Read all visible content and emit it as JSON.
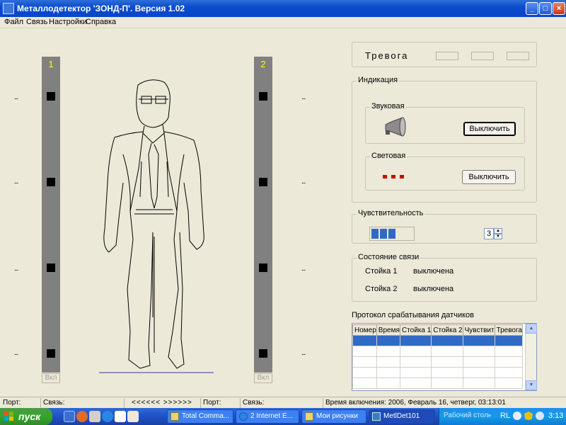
{
  "window": {
    "title": "Металлодетектор 'ЗОНД-П'. Версия 1.02",
    "min": "_",
    "max": "□",
    "close": "×"
  },
  "menu": [
    "Файл",
    "Связь",
    "Настройки",
    "Справка"
  ],
  "columns": [
    {
      "number": "1",
      "button": "Вкл"
    },
    {
      "number": "2",
      "button": "Вкл"
    }
  ],
  "dots": "...",
  "alarm": {
    "label": "Тревога"
  },
  "indication": {
    "title": "Индикация",
    "sound": {
      "title": "Звуковая",
      "button": "Выключить"
    },
    "light": {
      "title": "Световая",
      "button": "Выключить",
      "led_color": "#d40000"
    }
  },
  "sensitivity": {
    "title": "Чувствительность",
    "level": 3,
    "max_level": 5,
    "value": "3"
  },
  "connection": {
    "title": "Состояние связи",
    "rows": [
      {
        "name": "Стойка 1",
        "state": "выключена"
      },
      {
        "name": "Стойка 2",
        "state": "выключена"
      }
    ]
  },
  "log": {
    "title": "Протокол срабатывания датчиков",
    "columns": [
      "Номер",
      "Время",
      "Стойка 1",
      "Стойка 2",
      "Чувствит",
      "Тревога"
    ],
    "rows": 5
  },
  "statusbar": {
    "port_label": "Порт:",
    "link_label": "Связь:",
    "arrows": "<<<<<<  >>>>>>",
    "port_label2": "Порт:",
    "link_label2": "Связь:",
    "start_time": "Время включения: 2006, Февраль 16, четверг,  03:13:01"
  },
  "taskbar": {
    "start": "пуск",
    "tasks": [
      {
        "label": "Total Comma..."
      },
      {
        "label": "2 Internet E..."
      },
      {
        "label": "Мои рисунки"
      },
      {
        "label": "MetlDet101"
      }
    ],
    "desktop": "Рабочий стол",
    "lang": "RL",
    "clock": "3:13"
  },
  "colors": {
    "accent": "#316ac5",
    "column": "#808080",
    "column_number": "#ffff00"
  }
}
